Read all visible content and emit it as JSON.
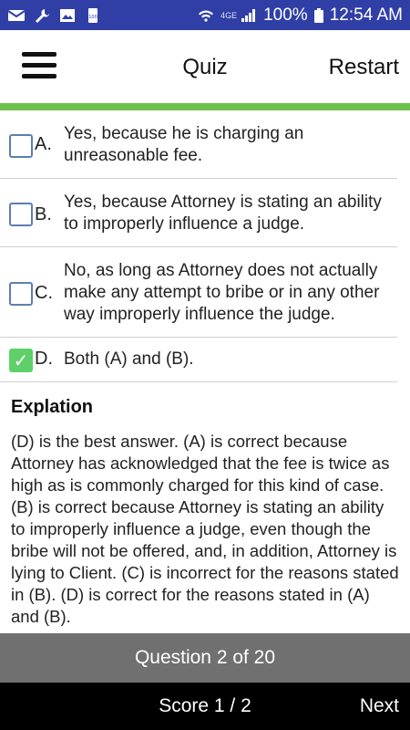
{
  "status_bar": {
    "icons_left": [
      "mail-icon",
      "wrench-icon",
      "image-icon",
      "battery-100-icon"
    ],
    "battery_small_label": "100",
    "network": "4GE",
    "battery_percent": "100%",
    "time": "12:54 AM"
  },
  "app_bar": {
    "title": "Quiz",
    "restart_label": "Restart"
  },
  "options": [
    {
      "letter": "A.",
      "text": "Yes, because he is charging an unreasonable fee.",
      "checked": false
    },
    {
      "letter": "B.",
      "text": "Yes, because Attorney is stating an ability to improperly influence a judge.",
      "checked": false
    },
    {
      "letter": "C.",
      "text": "No, as long as Attorney does not actually make any attempt to bribe or in any other way improperly influence the judge.",
      "checked": false
    },
    {
      "letter": "D.",
      "text": "Both (A) and (B).",
      "checked": true
    }
  ],
  "explanation": {
    "title": "Explation",
    "body": "(D) is the best answer. (A) is correct because Attorney has acknowledged that the fee is twice as high as is commonly charged for this kind of case. (B) is correct because Attorney is stating an ability to improperly influence a judge, even though the bribe will not be offered, and, in addition, Attorney is lying to Client. (C) is incorrect for the reasons stated in (B). (D) is correct for the reasons stated in (A) and (B)."
  },
  "footer": {
    "question_progress": "Question 2 of 20",
    "score": "Score 1 / 2",
    "next_label": "Next"
  },
  "colors": {
    "status_bar": "#303fa6",
    "accent_line": "#6cc24a",
    "checkbox_checked": "#5fcf6a",
    "question_bar": "#707070",
    "nav_bar": "#000000"
  }
}
